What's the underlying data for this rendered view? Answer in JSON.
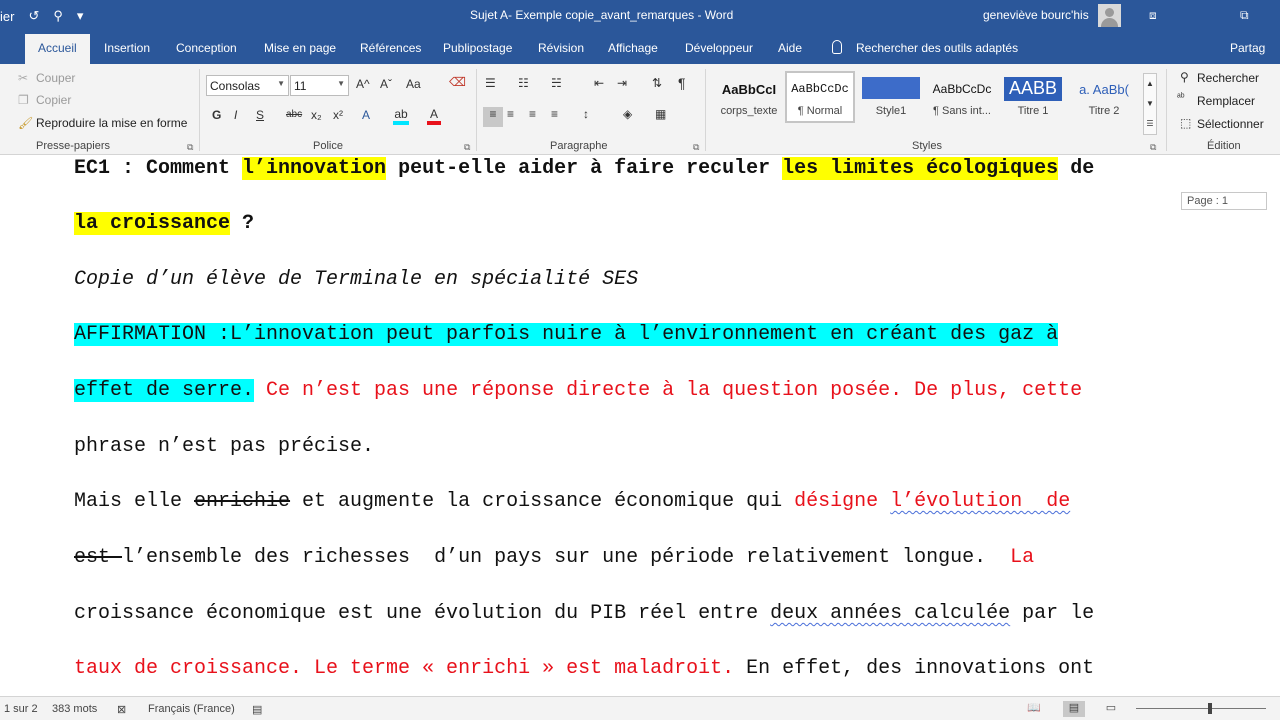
{
  "titlebar": {
    "title": "Sujet A- Exemple copie_avant_remarques  -  Word",
    "user": "geneviève bourc'his",
    "qat": [
      "ier",
      "↺",
      "⚲",
      "▾",
      "≡"
    ],
    "win_restore": "⧈",
    "win_min": "⧉"
  },
  "tabs": {
    "items": [
      "Accueil",
      "Insertion",
      "Conception",
      "Mise en page",
      "Références",
      "Publipostage",
      "Révision",
      "Affichage",
      "Développeur",
      "Aide"
    ],
    "active": "Accueil",
    "search": "Rechercher des outils adaptés",
    "share": "Partag"
  },
  "clipboard": {
    "cut": "Couper",
    "copy": "Copier",
    "format_painter": "Reproduire la mise en forme",
    "label": "Presse-papiers"
  },
  "font": {
    "name": "Consolas",
    "size": "11",
    "label": "Police",
    "grow": "A^",
    "shrink": "Aˇ",
    "case": "Aa",
    "bold": "G",
    "italic": "I",
    "underline": "S",
    "strike": "abc",
    "sub": "x₂",
    "sup": "x²",
    "effects": "A",
    "highlight": "ab",
    "color": "A",
    "accent_red": "#e8111b",
    "accent_yellow": "#ffff00"
  },
  "paragraph": {
    "label": "Paragraphe",
    "pilcrow": "¶"
  },
  "styles": {
    "label": "Styles",
    "items": [
      {
        "preview": "AaBbCcI",
        "name": "corps_texte"
      },
      {
        "preview": "AaBbCcDc",
        "name": "¶ Normal"
      },
      {
        "preview": "",
        "name": "Style1"
      },
      {
        "preview": "AaBbCcDc",
        "name": "¶ Sans int..."
      },
      {
        "preview": "AABB",
        "name": "Titre 1"
      },
      {
        "preview": "a.  AaBb(",
        "name": "Titre 2"
      }
    ]
  },
  "editing": {
    "label": "Édition",
    "find": "Rechercher",
    "replace": "Remplacer",
    "select": "Sélectionner"
  },
  "document": {
    "page_label": "Page : 1",
    "title_part1": "EC1 : Comment ",
    "title_hl1": "l’innovation",
    "title_part2": " peut-elle aider à faire reculer ",
    "title_hl2": "les limites écologiques",
    "title_part3": " de",
    "title2_hl": "la croissance",
    "title2_rest": " ?",
    "subtitle": "Copie d’un élève de Terminale en spécialité SES",
    "affirmation_l1": "AFFIRMATION :L’innovation peut parfois nuire à l’environnement en créant des gaz à",
    "affirmation_l2": "effet de serre.",
    "remark1_l2": " Ce n’est pas une réponse directe à la question posée. De plus, cette",
    "remark1_l3": "phrase n’est pas précise.",
    "p2_a": "Mais elle ",
    "p2_strike": "enrichie",
    "p2_b": " et augmente la croissance économique qui ",
    "p2_red1": "désigne",
    "p2_space": " ",
    "p2_red2": "l’évolution  de",
    "p3_strike": "est ",
    "p3_b": "l’ensemble des richesses  d’un pays sur une période relativement longue.  ",
    "p3_red": "La",
    "p4_a": "croissance économique est une évolution du PIB réel entre ",
    "p4_squig": "deux années calculée",
    "p4_b": " par le",
    "p5_red": "taux de croissance. Le terme « enrichi » est maladroit.",
    "p5_black": " En effet, des innovations ont"
  },
  "statusbar": {
    "page": "1 sur 2",
    "words": "383 mots",
    "language": "Français (France)"
  }
}
